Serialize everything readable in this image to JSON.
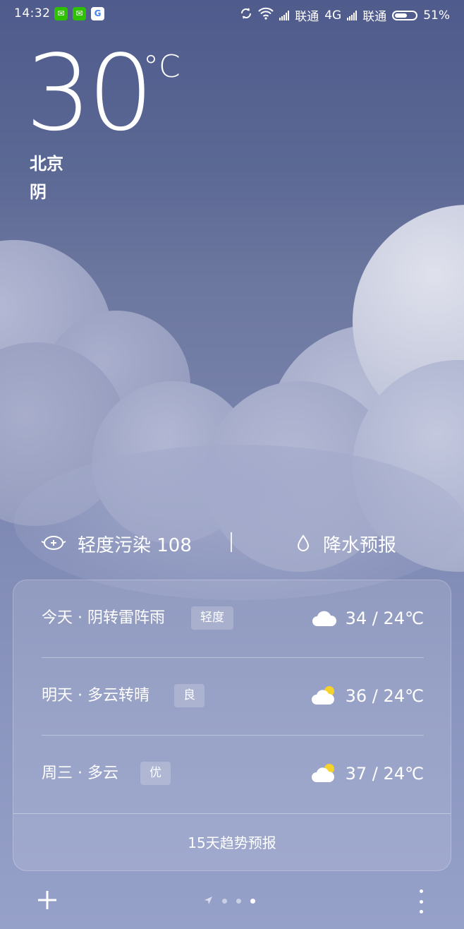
{
  "status_bar": {
    "time": "14:32",
    "notifications": [
      "wechat-icon",
      "wechat-icon",
      "google-icon"
    ],
    "carrier1": "联通",
    "network1": "4G",
    "carrier2": "联通",
    "battery": "51%",
    "battery_level": 0.51
  },
  "weather": {
    "temperature": "30",
    "unit": "°C",
    "city": "北京",
    "condition": "阴"
  },
  "air_quality": {
    "label": "轻度污染 108",
    "icon": "mask-icon"
  },
  "precipitation": {
    "label": "降水预报",
    "icon": "water-drop-icon"
  },
  "forecast": {
    "days": [
      {
        "day": "今天 · 阴转雷阵雨",
        "aqi": "轻度",
        "icon": "cloud-icon",
        "temp": "34 / 24℃"
      },
      {
        "day": "明天 · 多云转晴",
        "aqi": "良",
        "icon": "partly-sunny-icon",
        "temp": "36 / 24℃"
      },
      {
        "day": "周三 · 多云",
        "aqi": "优",
        "icon": "partly-sunny-icon",
        "temp": "37 / 24℃"
      }
    ],
    "footer": "15天趋势预报"
  },
  "colors": {
    "background_top": "#4f5b8c",
    "background_bottom": "#96a1c9",
    "text": "#ffffff",
    "wechat": "#2dc100",
    "sun": "#f5d32a"
  }
}
